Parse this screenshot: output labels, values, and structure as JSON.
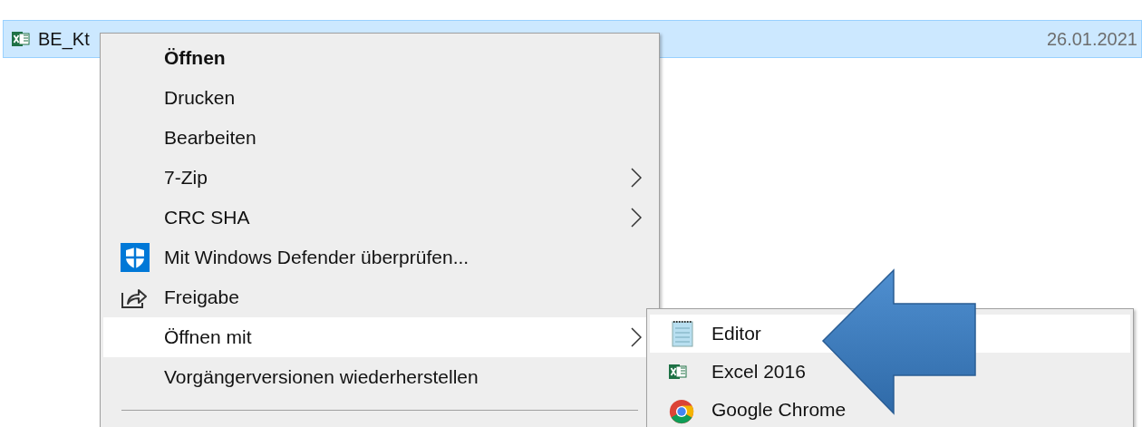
{
  "file_row": {
    "name": "BE_Kt",
    "date": "26.01.2021",
    "selected": true
  },
  "context_menu": {
    "items": [
      {
        "label": "Öffnen",
        "kind": "default",
        "selected": false
      },
      {
        "label": "Drucken",
        "kind": "plain",
        "selected": false
      },
      {
        "label": "Bearbeiten",
        "kind": "plain",
        "selected": false
      },
      {
        "label": "7-Zip",
        "kind": "submenu",
        "selected": false
      },
      {
        "label": "CRC SHA",
        "kind": "submenu",
        "selected": false
      },
      {
        "label": "Mit Windows Defender überprüfen...",
        "kind": "shield",
        "selected": false
      },
      {
        "label": "Freigabe",
        "kind": "share",
        "selected": false
      },
      {
        "label": "Öffnen mit",
        "kind": "submenu",
        "selected": true
      },
      {
        "label": "Vorgängerversionen wiederherstellen",
        "kind": "plain",
        "selected": false
      },
      {
        "kind": "separator"
      }
    ]
  },
  "open_with_menu": {
    "items": [
      {
        "label": "Editor",
        "kind": "notepad",
        "selected": true
      },
      {
        "label": "Excel 2016",
        "kind": "excel",
        "selected": false
      },
      {
        "label": "Google Chrome",
        "kind": "chrome",
        "selected": false
      }
    ]
  }
}
